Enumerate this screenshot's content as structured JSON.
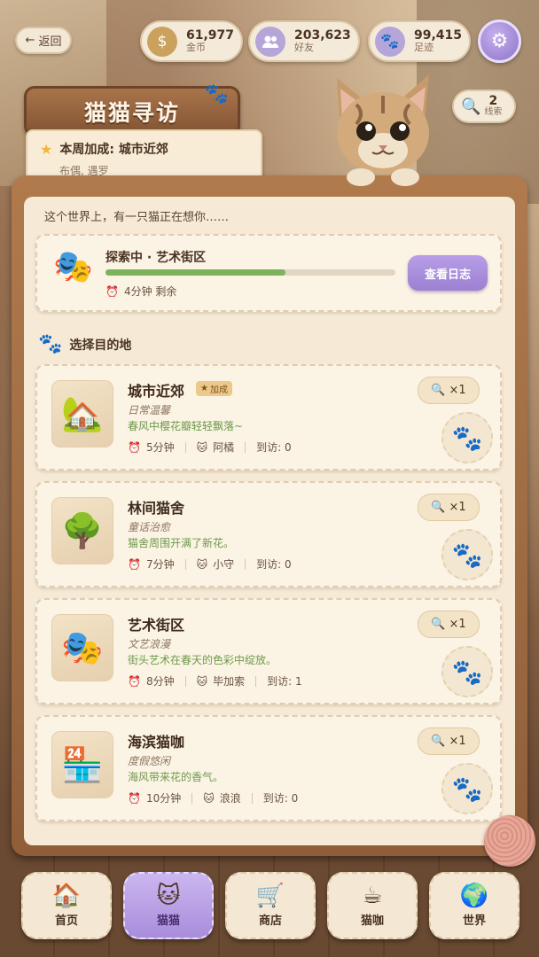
{
  "header": {
    "back_label": "返回",
    "resources": [
      {
        "value": "61,977",
        "label": "金币",
        "icon": "coin-bag-icon"
      },
      {
        "value": "203,623",
        "label": "好友",
        "icon": "friends-icon"
      },
      {
        "value": "99,415",
        "label": "足迹",
        "icon": "paw-icon"
      }
    ],
    "settings_icon": "gear-icon"
  },
  "sign": {
    "title": "猫猫寻访",
    "bonus_title": "本周加成: 城市近郊",
    "bonus_sub": "布偶, 遇罗"
  },
  "clues": {
    "count": "2",
    "label": "线索"
  },
  "board": {
    "intro": "这个世界上，有一只猫正在想你……",
    "exploring": {
      "title": "探索中 · 艺术街区",
      "time_left": "4分钟 剩余",
      "progress": 0.62,
      "log_button": "查看日志",
      "icon": "theater-masks-icon"
    },
    "section_title": "选择目的地",
    "destinations": [
      {
        "name": "城市近郊",
        "badge": "加成",
        "style": "日常温馨",
        "desc": "春风中樱花瓣轻轻飘落~",
        "time": "5分钟",
        "cat": "阿橘",
        "visits": "到访: 0",
        "cost": "×1",
        "thumb": "🏡"
      },
      {
        "name": "林间猫舍",
        "badge": "",
        "style": "童话治愈",
        "desc": "猫舍周围开满了新花。",
        "time": "7分钟",
        "cat": "小守",
        "visits": "到访: 0",
        "cost": "×1",
        "thumb": "🌳"
      },
      {
        "name": "艺术街区",
        "badge": "",
        "style": "文艺浪漫",
        "desc": "街头艺术在春天的色彩中绽放。",
        "time": "8分钟",
        "cat": "毕加索",
        "visits": "到访: 1",
        "cost": "×1",
        "thumb": "🎭"
      },
      {
        "name": "海滨猫咖",
        "badge": "",
        "style": "度假悠闲",
        "desc": "海风带来花的香气。",
        "time": "10分钟",
        "cat": "浪浪",
        "visits": "到访: 0",
        "cost": "×1",
        "thumb": "🏪"
      }
    ]
  },
  "nav": [
    {
      "label": "首页",
      "icon": "house-icon",
      "glyph": "🏠"
    },
    {
      "label": "猫猫",
      "icon": "cat-face-icon",
      "glyph": "🐱"
    },
    {
      "label": "商店",
      "icon": "shopping-cart-icon",
      "glyph": "🛒"
    },
    {
      "label": "猫咖",
      "icon": "coffee-cup-icon",
      "glyph": "☕"
    },
    {
      "label": "世界",
      "icon": "globe-icon",
      "glyph": "🌍"
    }
  ],
  "colors": {
    "accent_purple": "#a88ddb",
    "progress_green": "#7cb35a",
    "wood": "#8f5e39",
    "paper": "#f6ead6"
  }
}
